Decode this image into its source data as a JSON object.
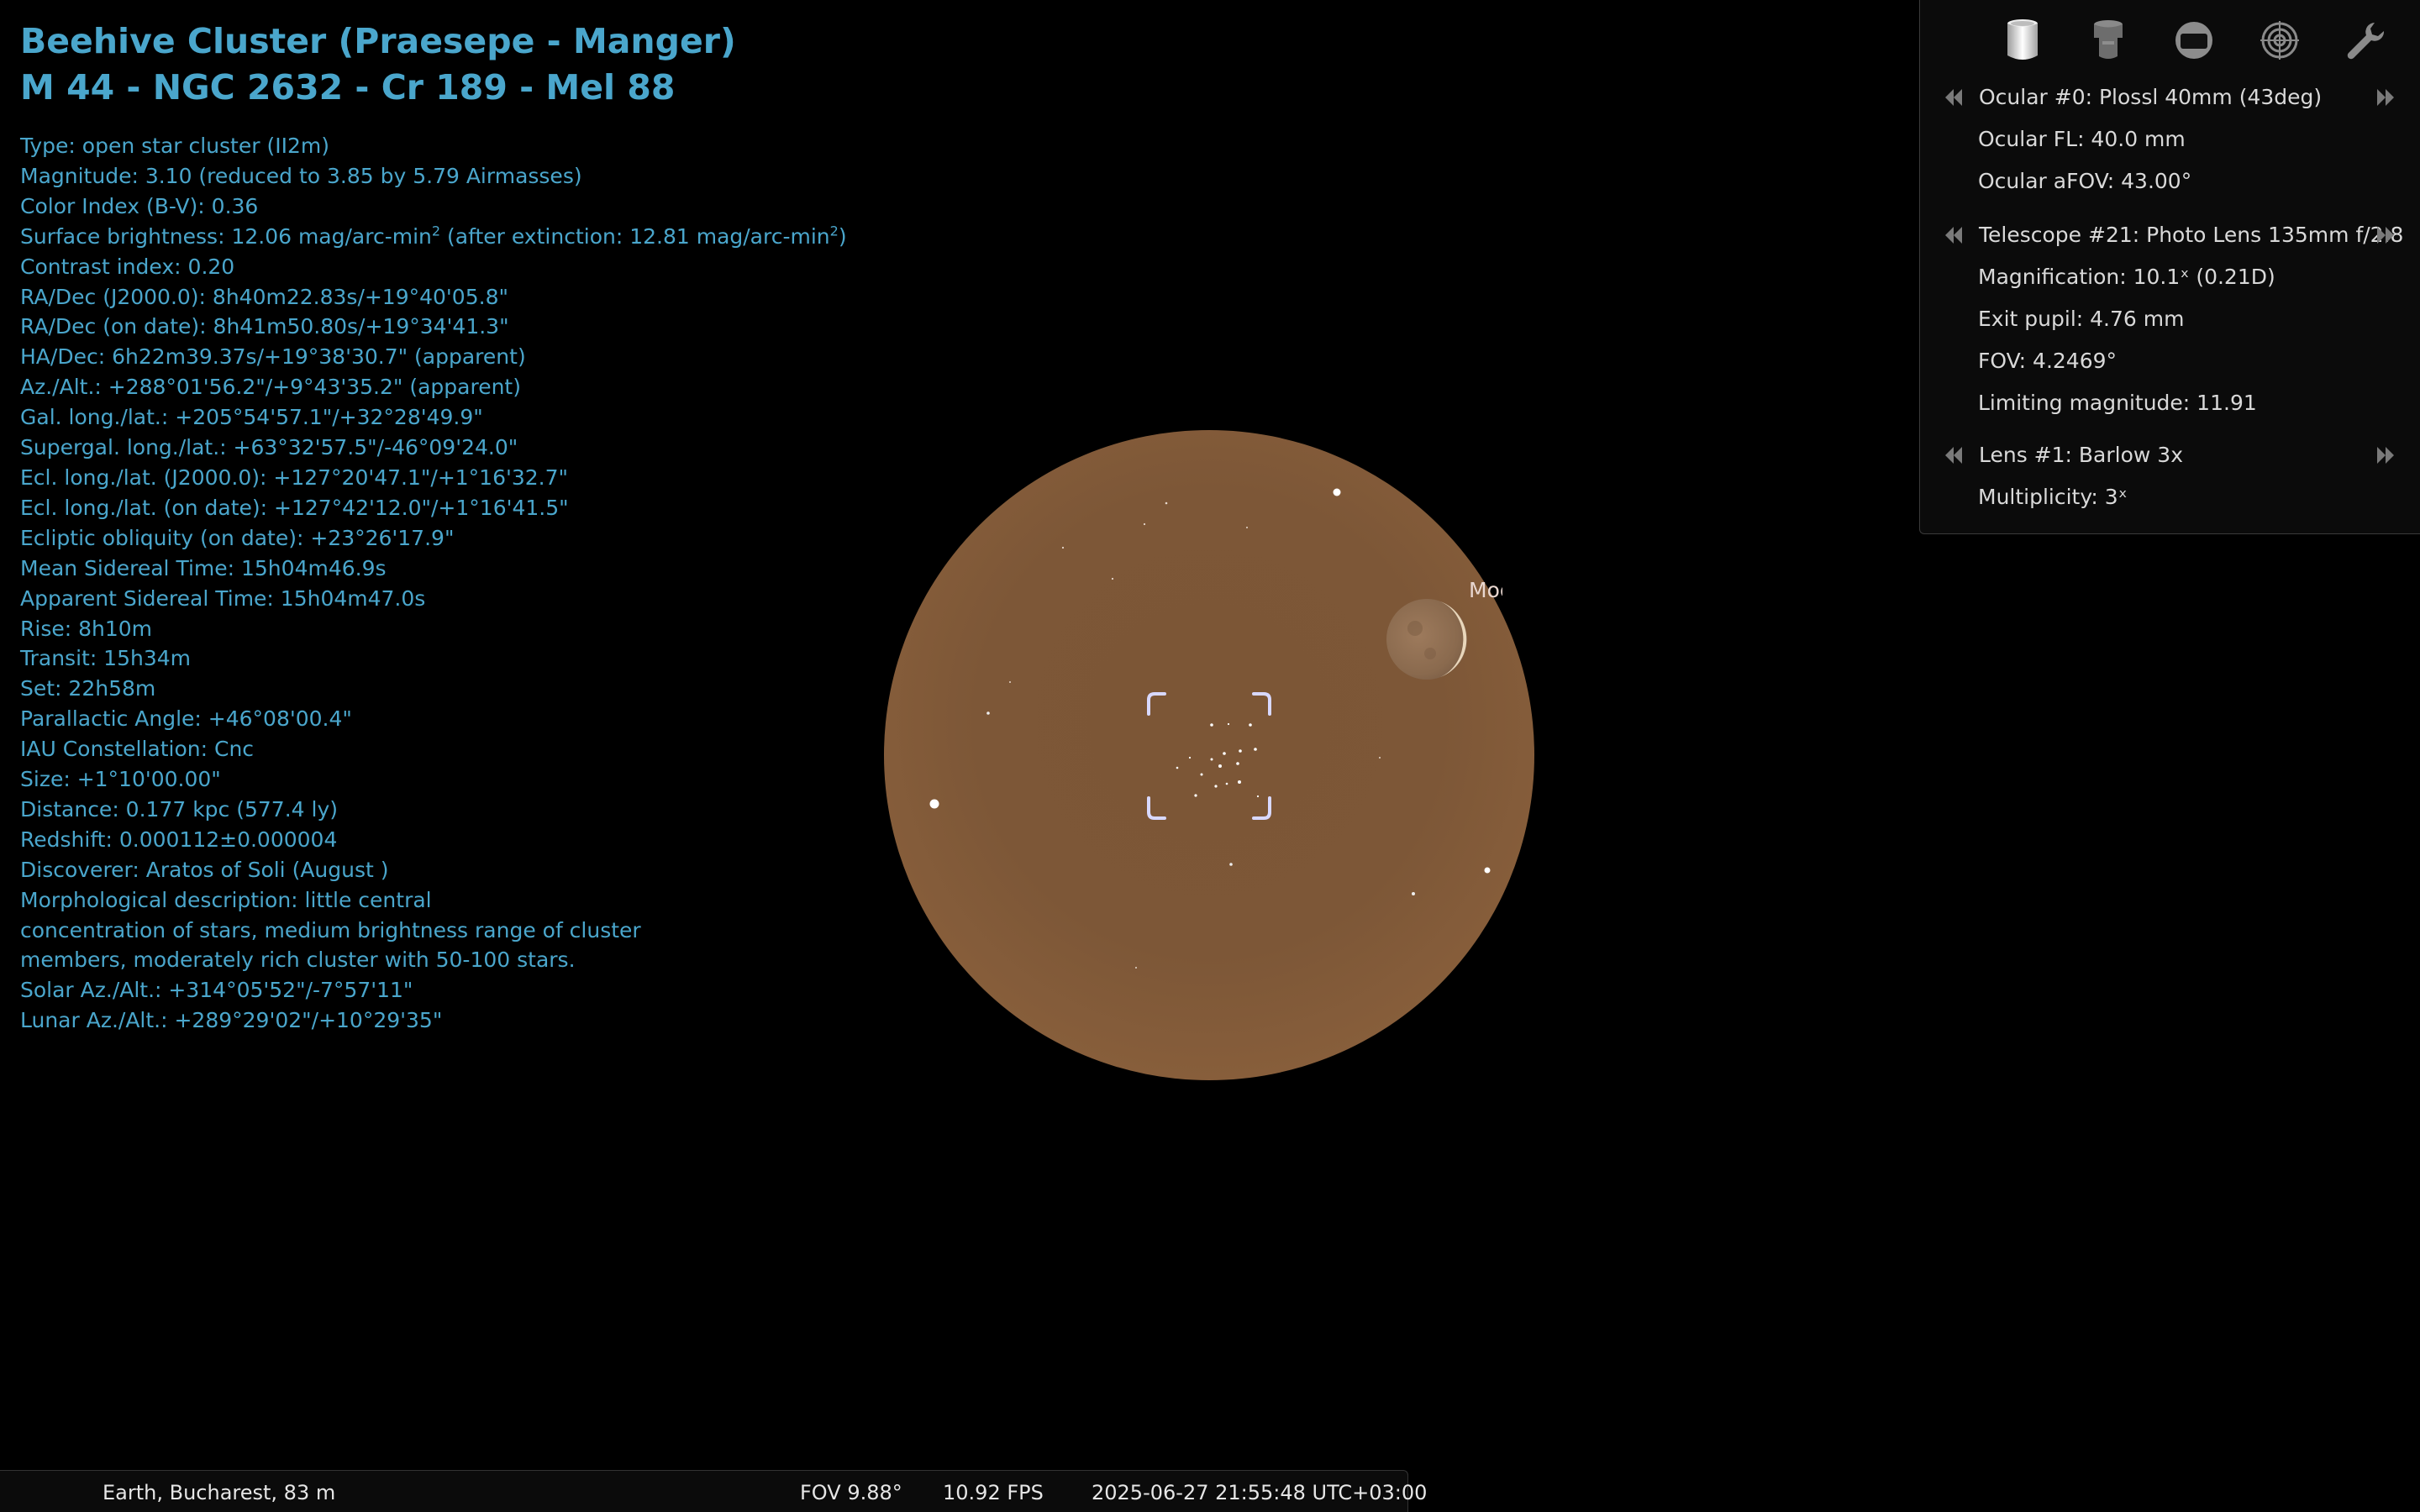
{
  "object": {
    "title_line1": "Beehive Cluster (Praesepe - Manger)",
    "title_line2": "M 44 - NGC 2632 - Cr 189 - Mel 88",
    "type": "Type: open star cluster (II2m)",
    "magnitude": "Magnitude: 3.10 (reduced to 3.85 by 5.79 Airmasses)",
    "color_index": "Color Index (B-V): 0.36",
    "surface_brightness_a": "Surface brightness: 12.06 mag/arc-min",
    "surface_brightness_b": " (after extinction: 12.81 mag/arc-min",
    "surface_brightness_c": ")",
    "sup_two": "2",
    "contrast_index": "Contrast index: 0.20",
    "radec_j2000": "RA/Dec (J2000.0): 8h40m22.83s/+19°40'05.8\"",
    "radec_date": "RA/Dec (on date): 8h41m50.80s/+19°34'41.3\"",
    "hadec": "HA/Dec: 6h22m39.37s/+19°38'30.7\" (apparent)",
    "azalt": "Az./Alt.: +288°01'56.2\"/+9°43'35.2\" (apparent)",
    "gal": "Gal. long./lat.: +205°54'57.1\"/+32°28'49.9\"",
    "supergal": "Supergal. long./lat.: +63°32'57.5\"/-46°09'24.0\"",
    "ecl_j2000": "Ecl. long./lat. (J2000.0): +127°20'47.1\"/+1°16'32.7\"",
    "ecl_date": "Ecl. long./lat. (on date): +127°42'12.0\"/+1°16'41.5\"",
    "ecl_obliquity": "Ecliptic obliquity (on date): +23°26'17.9\"",
    "mean_sidereal": "Mean Sidereal Time: 15h04m46.9s",
    "apparent_sidereal": "Apparent Sidereal Time: 15h04m47.0s",
    "rise": "Rise: 8h10m",
    "transit": "Transit: 15h34m",
    "set": "Set: 22h58m",
    "parallactic": "Parallactic Angle: +46°08'00.4\"",
    "constellation": "IAU Constellation: Cnc",
    "size": "Size: +1°10'00.00\"",
    "distance": "Distance: 0.177 kpc (577.4 ly)",
    "redshift": "Redshift: 0.000112±0.000004",
    "discoverer": "Discoverer: Aratos of Soli (August )",
    "morph1": "Morphological description: little central",
    "morph2": "concentration of stars, medium brightness range of cluster",
    "morph3": "members, moderately rich cluster with 50-100 stars.",
    "solar_azalt": "Solar Az./Alt.: +314°05'52\"/-7°57'11\"",
    "lunar_azalt": "Lunar Az./Alt.: +289°29'02\"/+10°29'35\""
  },
  "sky": {
    "moon_label": "Moon",
    "ocular_tint": "#7a5638",
    "marker_color": "#cfd0ff"
  },
  "panel": {
    "tools": [
      "ocular-icon",
      "telescope-icon",
      "sensor-frame-icon",
      "crosshair-icon",
      "wrench-icon"
    ],
    "ocular": "Ocular #0: Plossl 40mm (43deg)",
    "ocular_fl": "Ocular FL: 40.0 mm",
    "ocular_afov": "Ocular aFOV: 43.00°",
    "telescope": "Telescope #21: Photo Lens 135mm f/2.8",
    "magnification": "Magnification: 10.1ˣ (0.21D)",
    "exit_pupil": "Exit pupil: 4.76 mm",
    "fov": "FOV: 4.2469°",
    "limiting_mag": "Limiting magnitude: 11.91",
    "lens": "Lens #1: Barlow 3x",
    "multiplicity": "Multiplicity: 3ˣ"
  },
  "status": {
    "location": "Earth, Bucharest, 83 m",
    "fov": "FOV 9.88°",
    "fps": "10.92 FPS",
    "datetime": "2025-06-27 21:55:48 UTC+03:00"
  },
  "colors": {
    "info_text": "#4aa6cc",
    "panel_text": "#d9d9d9",
    "background": "#000000"
  }
}
